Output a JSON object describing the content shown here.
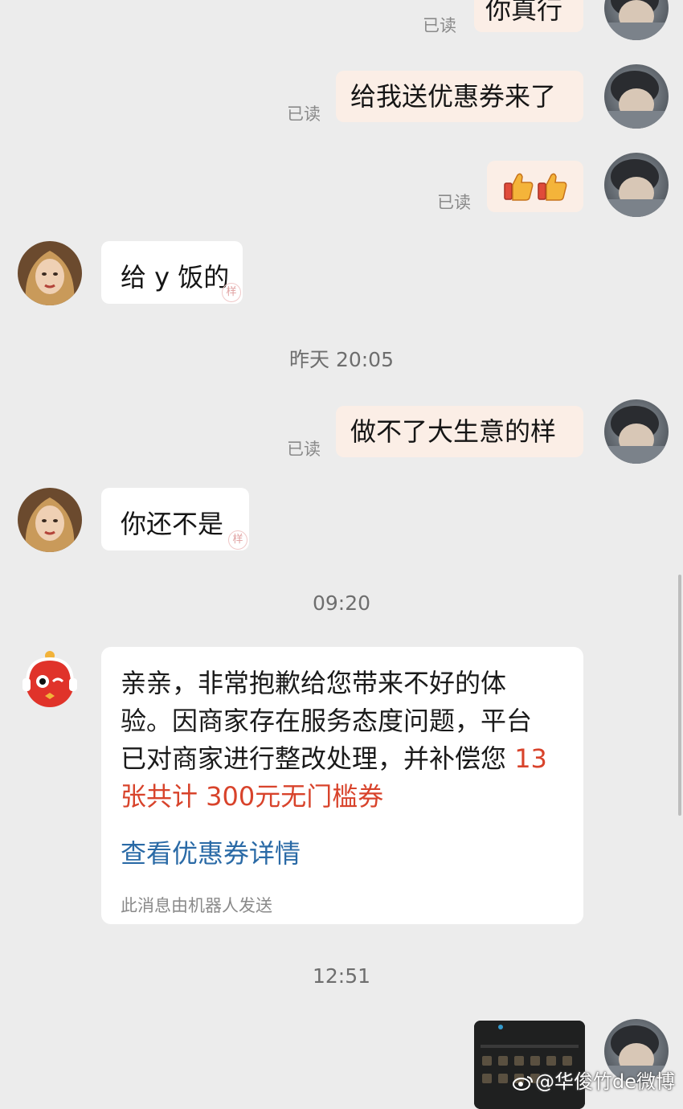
{
  "messages": {
    "m1": {
      "text": "你真行",
      "read": "已读"
    },
    "m2": {
      "text": "给我送优惠券来了",
      "read": "已读"
    },
    "m3": {
      "emoji": "👍👍",
      "read": "已读"
    },
    "m4": {
      "text": "给 y 饭的"
    },
    "t1": "昨天 20:05",
    "m5": {
      "text": "做不了大生意的样",
      "read": "已读"
    },
    "m6": {
      "text": "你还不是"
    },
    "t2": "09:20",
    "bot": {
      "text_line1": "亲亲，非常抱歉给您带来不好的体",
      "text_line2": "验。因商家存在服务态度问题，平台",
      "text_line3_a": "已对商家进行整改处理，并补偿您 ",
      "text_line3_b": "13",
      "text_line4": "张共计 300元无门槛券",
      "link": "查看优惠券详情",
      "note": "此消息由机器人发送"
    },
    "t3": "12:51"
  },
  "watermark": "@华俊竹de微博",
  "colors": {
    "background": "#ececec",
    "my_bubble": "#fbeee6",
    "their_bubble": "#ffffff",
    "highlight": "#d8432b",
    "link": "#2a6aa6"
  }
}
